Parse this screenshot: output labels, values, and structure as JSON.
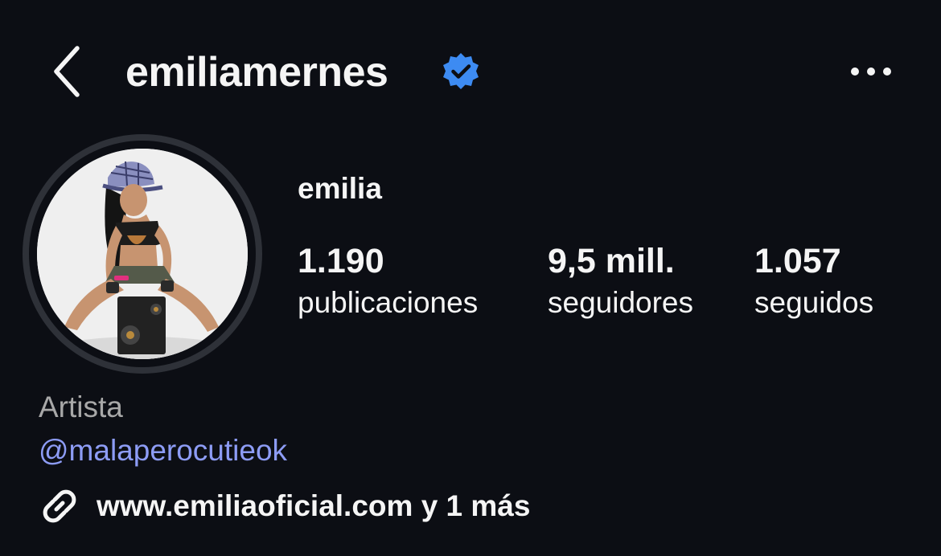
{
  "header": {
    "username": "emiliamernes",
    "verified": true,
    "back_icon": "chevron-left-icon",
    "more_icon": "more-horizontal-icon"
  },
  "profile": {
    "display_name": "emilia",
    "avatar_icon": "profile-photo"
  },
  "stats": [
    {
      "value": "1.190",
      "label": "publicaciones"
    },
    {
      "value": "9,5 mill.",
      "label": "seguidores"
    },
    {
      "value": "1.057",
      "label": "seguidos"
    }
  ],
  "bio": {
    "category": "Artista",
    "mention": "@malaperocutieok",
    "link_text": "www.emiliaoficial.com y 1 más",
    "link_icon": "link-icon"
  },
  "colors": {
    "background": "#0c0e14",
    "text": "#f5f5f5",
    "muted": "#a8a8a8",
    "mention": "#8d9cf5",
    "verified": "#3d8bf2",
    "ring": "#2e3138"
  }
}
